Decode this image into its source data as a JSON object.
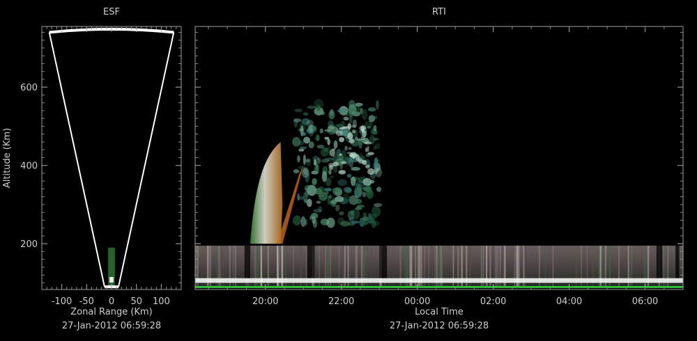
{
  "chart_data": [
    {
      "panel": "ESF",
      "type": "scatter",
      "title": "ESF",
      "xlabel": "Zonal Range (Km)",
      "ylabel": "Altitude (Km)",
      "timestamp": "27-Jan-2012 06:59:28",
      "xlim": [
        -140,
        140
      ],
      "ylim": [
        83,
        755
      ],
      "x_ticks": [
        "-100",
        "-50",
        "0",
        "50",
        "100"
      ],
      "x_tick_values": [
        -100,
        -50,
        0,
        50,
        100
      ],
      "y_ticks": [
        "200",
        "400",
        "600"
      ],
      "y_tick_values": [
        200,
        400,
        600
      ],
      "beam_fan": {
        "apex": [
          0,
          90
        ],
        "left_edge": [
          -125,
          740
        ],
        "right_edge": [
          125,
          740
        ]
      },
      "echo": {
        "x": [
          -4,
          4
        ],
        "y": [
          90,
          190
        ]
      }
    },
    {
      "panel": "RTI",
      "type": "heatmap",
      "title": "RTI",
      "xlabel": "Local Time",
      "timestamp": "27-Jan-2012 06:59:28",
      "x_ticks": [
        "20:00",
        "22:00",
        "00:00",
        "02:00",
        "04:00",
        "06:00"
      ],
      "x_tick_hours": [
        20,
        22,
        24,
        26,
        28,
        30
      ],
      "xlim_hours": [
        18.15,
        31.0
      ],
      "ylim": [
        83,
        755
      ],
      "y_ticks": [
        "200",
        "400",
        "600"
      ],
      "y_tick_values": [
        200,
        400,
        600
      ],
      "echo_regions": [
        {
          "t": [
            18.15,
            31.0
          ],
          "alt": [
            90,
            195
          ],
          "color": "#8a7878"
        },
        {
          "t": [
            18.15,
            31.0
          ],
          "alt": [
            100,
            112
          ],
          "color": "#ffffff"
        },
        {
          "t": [
            19.6,
            20.4
          ],
          "alt": [
            200,
            460
          ],
          "color": "#e8dccc"
        },
        {
          "t": [
            20.3,
            21.0
          ],
          "alt": [
            200,
            460
          ],
          "color": "#c86a1c"
        },
        {
          "t": [
            20.8,
            23.0
          ],
          "alt": [
            250,
            560
          ],
          "color": "#3c7a5a"
        },
        {
          "t": [
            21.6,
            22.8
          ],
          "alt": [
            380,
            500
          ],
          "color": "#b8d8c8"
        }
      ]
    }
  ]
}
